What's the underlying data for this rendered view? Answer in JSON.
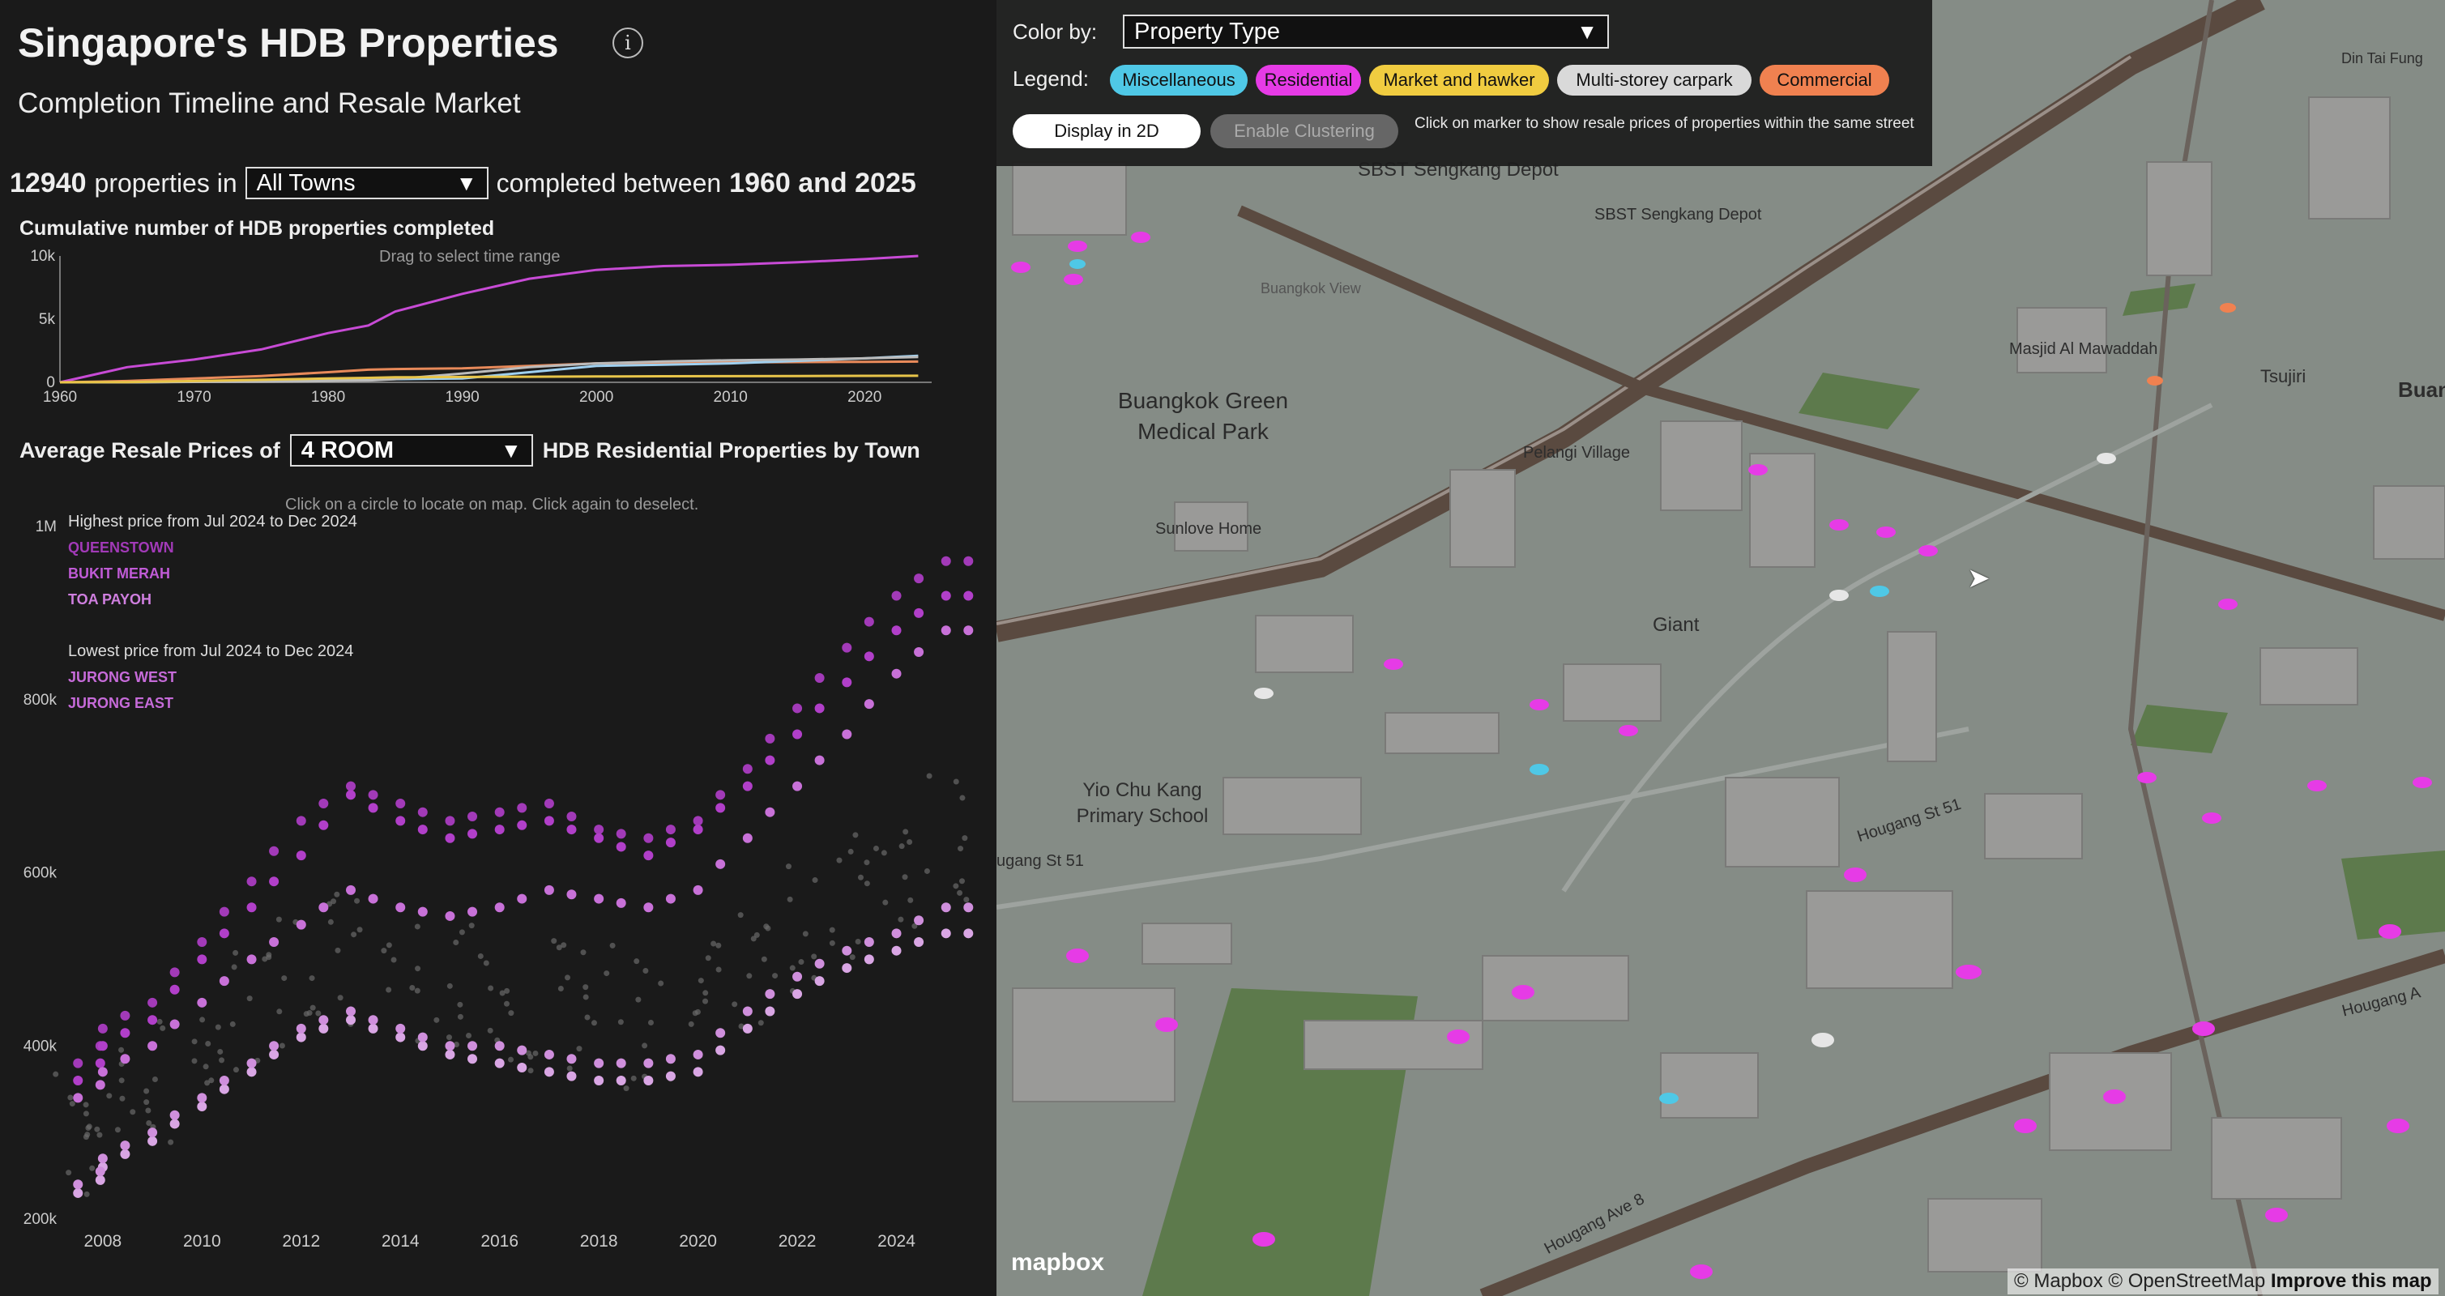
{
  "header": {
    "title": "Singapore's HDB Properties",
    "subtitle": "Completion Timeline and Resale Market"
  },
  "summary": {
    "count": "12940",
    "properties_in": "properties in",
    "town_select": "All Towns",
    "completed_between": "completed between",
    "year_range": "1960 and 2025"
  },
  "timeline": {
    "title": "Cumulative number of HDB properties completed",
    "hint": "Drag to select time range"
  },
  "resale": {
    "label_prefix": "Average Resale Prices of",
    "flat_select": "4 ROOM",
    "label_suffix": "HDB Residential Properties by Town",
    "hint": "Click on a circle to locate on map. Click again to deselect.",
    "highest_label": "Highest price from Jul 2024 to Dec 2024",
    "highest_towns": [
      "QUEENSTOWN",
      "BUKIT MERAH",
      "TOA PAYOH"
    ],
    "lowest_label": "Lowest price from Jul 2024 to Dec 2024",
    "lowest_towns": [
      "JURONG WEST",
      "JURONG EAST"
    ]
  },
  "chart_data": [
    {
      "type": "line",
      "title": "Cumulative number of HDB properties completed",
      "x_ticks": [
        "1960",
        "1970",
        "1980",
        "1990",
        "2000",
        "2010",
        "2020"
      ],
      "y_ticks": [
        "0",
        "5k",
        "10k"
      ],
      "ylim": [
        0,
        10000
      ],
      "xlim": [
        1960,
        2025
      ],
      "x": [
        1960,
        1965,
        1970,
        1975,
        1980,
        1983,
        1985,
        1990,
        1995,
        2000,
        2005,
        2010,
        2015,
        2020,
        2024
      ],
      "series": [
        {
          "color": "#c84bd6",
          "values": [
            0,
            1200,
            1800,
            2600,
            3900,
            4500,
            5600,
            7000,
            8200,
            8900,
            9200,
            9300,
            9500,
            9750,
            10000
          ]
        },
        {
          "color": "#e88a5a",
          "values": [
            0,
            100,
            300,
            500,
            800,
            1000,
            1050,
            1100,
            1300,
            1500,
            1550,
            1580,
            1600,
            1620,
            1640
          ]
        },
        {
          "color": "#9fd0f0",
          "values": [
            0,
            0,
            50,
            100,
            150,
            200,
            250,
            300,
            800,
            1300,
            1400,
            1500,
            1700,
            1900,
            2100
          ]
        },
        {
          "color": "#bbbbbb",
          "values": [
            0,
            0,
            30,
            60,
            100,
            150,
            250,
            700,
            1200,
            1500,
            1650,
            1750,
            1800,
            1900,
            2000
          ]
        },
        {
          "color": "#e8c54a",
          "values": [
            0,
            20,
            100,
            200,
            300,
            350,
            400,
            420,
            440,
            460,
            480,
            490,
            500,
            510,
            520
          ]
        }
      ]
    },
    {
      "type": "scatter",
      "title": "Average Resale Prices of 4 ROOM HDB Residential Properties by Town",
      "x_ticks": [
        "2008",
        "2010",
        "2012",
        "2014",
        "2016",
        "2018",
        "2020",
        "2022",
        "2024"
      ],
      "y_ticks": [
        "200k",
        "400k",
        "600k",
        "800k",
        "1M"
      ],
      "ylim": [
        200000,
        1000000
      ],
      "xlim": [
        2007.3,
        2025.2
      ],
      "series": [
        {
          "name": "QUEENSTOWN",
          "color": "#a23ab8",
          "x": [
            2007.5,
            2008,
            2009,
            2010,
            2011,
            2012,
            2013,
            2014,
            2015,
            2016,
            2017,
            2018,
            2019,
            2020,
            2021,
            2022,
            2023,
            2024,
            2025
          ],
          "values": [
            380000,
            420000,
            450000,
            520000,
            590000,
            660000,
            700000,
            680000,
            660000,
            670000,
            680000,
            650000,
            640000,
            660000,
            720000,
            790000,
            860000,
            920000,
            960000
          ]
        },
        {
          "name": "BUKIT MERAH",
          "color": "#b13fc9",
          "x": [
            2007.5,
            2008,
            2009,
            2010,
            2011,
            2012,
            2013,
            2014,
            2015,
            2016,
            2017,
            2018,
            2019,
            2020,
            2021,
            2022,
            2023,
            2024,
            2025
          ],
          "values": [
            360000,
            400000,
            430000,
            500000,
            560000,
            620000,
            690000,
            660000,
            640000,
            650000,
            660000,
            640000,
            620000,
            650000,
            700000,
            760000,
            820000,
            880000,
            920000
          ]
        },
        {
          "name": "TOA PAYOH",
          "color": "#c871d8",
          "x": [
            2007.5,
            2008,
            2009,
            2010,
            2011,
            2012,
            2013,
            2014,
            2015,
            2016,
            2017,
            2018,
            2019,
            2020,
            2021,
            2022,
            2023,
            2024,
            2025
          ],
          "values": [
            340000,
            370000,
            400000,
            450000,
            500000,
            540000,
            580000,
            560000,
            550000,
            560000,
            580000,
            570000,
            560000,
            580000,
            640000,
            700000,
            760000,
            830000,
            880000
          ]
        },
        {
          "name": "JURONG WEST",
          "color": "#d9a6e4",
          "x": [
            2007.5,
            2008,
            2009,
            2010,
            2011,
            2012,
            2013,
            2014,
            2015,
            2016,
            2017,
            2018,
            2019,
            2020,
            2021,
            2022,
            2023,
            2024,
            2025
          ],
          "values": [
            230000,
            260000,
            290000,
            330000,
            370000,
            410000,
            430000,
            410000,
            390000,
            380000,
            370000,
            360000,
            360000,
            370000,
            420000,
            460000,
            490000,
            510000,
            530000
          ]
        },
        {
          "name": "JURONG EAST",
          "color": "#cf8fdc",
          "x": [
            2007.5,
            2008,
            2009,
            2010,
            2011,
            2012,
            2013,
            2014,
            2015,
            2016,
            2017,
            2018,
            2019,
            2020,
            2021,
            2022,
            2023,
            2024,
            2025
          ],
          "values": [
            240000,
            270000,
            300000,
            340000,
            380000,
            420000,
            440000,
            420000,
            400000,
            400000,
            390000,
            380000,
            380000,
            390000,
            440000,
            480000,
            510000,
            530000,
            560000
          ]
        },
        {
          "name": "",
          "color": "#8a8a8a",
          "x": [
            2007.5,
            2008,
            2009,
            2010,
            2011,
            2012,
            2013,
            2014,
            2015,
            2016,
            2017,
            2018,
            2019,
            2020,
            2021,
            2022,
            2023,
            2024,
            2025
          ],
          "values": [
            300000,
            330000,
            360000,
            400000,
            440000,
            480000,
            500000,
            480000,
            460000,
            460000,
            450000,
            440000,
            430000,
            440000,
            490000,
            540000,
            580000,
            610000,
            640000
          ]
        }
      ]
    }
  ],
  "map": {
    "color_by_label": "Color by:",
    "color_by_value": "Property Type",
    "legend_label": "Legend:",
    "legend": [
      {
        "label": "Miscellaneous",
        "color": "#4fc8e6"
      },
      {
        "label": "Residential",
        "color": "#e63be6"
      },
      {
        "label": "Market and hawker",
        "color": "#f0cc40"
      },
      {
        "label": "Multi-storey carpark",
        "color": "#d9d9d9"
      },
      {
        "label": "Commercial",
        "color": "#f08150"
      }
    ],
    "display_2d": "Display in 2D",
    "enable_clustering": "Enable Clustering",
    "click_hint": "Click on marker to show resale prices of properties within the same street",
    "places": {
      "sengkang_depot_1": "SBST Sengkang Depot",
      "sengkang_depot_2": "SBST Sengkang Depot",
      "buangkok_view": "Buangkok View",
      "medical_park": "Buangkok Green Medical Park",
      "pelangi": "Pelangi Village",
      "sunlove": "Sunlove Home",
      "giant": "Giant",
      "masjid": "Masjid Al Mawaddah",
      "tsujiri": "Tsujiri",
      "buan": "Buan",
      "dintaifung": "Din Tai Fung",
      "yio_chu_kang": "Yio Chu Kang Primary School",
      "hougang_51_left": "ugang St 51",
      "hougang_51": "Hougang St 51",
      "hougang_ave8": "Hougang Ave 8",
      "hougang_right": "Hougang A"
    },
    "logo": "mapbox",
    "attribution_1": "© Mapbox © OpenStreetMap",
    "attribution_2": "Improve this map"
  }
}
